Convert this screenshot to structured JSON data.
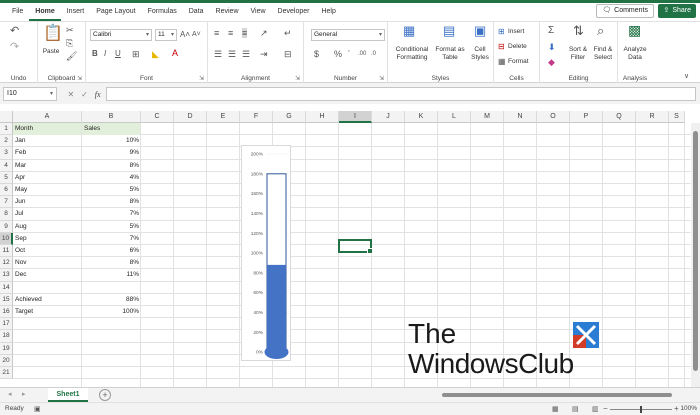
{
  "menu": {
    "tabs": [
      "File",
      "Home",
      "Insert",
      "Page Layout",
      "Formulas",
      "Data",
      "Review",
      "View",
      "Developer",
      "Help"
    ],
    "active": "Home",
    "comments_label": "Comments",
    "share_label": "Share"
  },
  "ribbon": {
    "undo_group": "Undo",
    "clipboard_group": "Clipboard",
    "paste_label": "Paste",
    "font_group": "Font",
    "font_name": "Calibri",
    "font_size": "11",
    "alignment_group": "Alignment",
    "number_group": "Number",
    "number_format": "General",
    "styles_group": "Styles",
    "conditional_formatting": "Conditional Formatting",
    "format_as_table": "Format as Table",
    "cell_styles": "Cell Styles",
    "cells_group": "Cells",
    "insert_label": "Insert",
    "delete_label": "Delete",
    "format_label": "Format",
    "editing_group": "Editing",
    "sort_filter": "Sort & Filter",
    "find_select": "Find & Select",
    "analysis_group": "Analysis",
    "analyze_data": "Analyze Data"
  },
  "formula_bar": {
    "name_box": "I10",
    "fx": "fx",
    "formula": ""
  },
  "columns": [
    "A",
    "B",
    "C",
    "D",
    "E",
    "F",
    "G",
    "H",
    "I",
    "J",
    "K",
    "L",
    "M",
    "N",
    "O",
    "P",
    "Q",
    "R",
    "S"
  ],
  "selected_column": "I",
  "selected_row": "10",
  "rows": [
    {
      "n": "1",
      "a": "Month",
      "b": "Sales",
      "header": true
    },
    {
      "n": "2",
      "a": "Jan",
      "b": "10%"
    },
    {
      "n": "3",
      "a": "Feb",
      "b": "9%"
    },
    {
      "n": "4",
      "a": "Mar",
      "b": "8%"
    },
    {
      "n": "5",
      "a": "Apr",
      "b": "4%"
    },
    {
      "n": "6",
      "a": "May",
      "b": "5%"
    },
    {
      "n": "7",
      "a": "Jun",
      "b": "8%"
    },
    {
      "n": "8",
      "a": "Jul",
      "b": "7%"
    },
    {
      "n": "9",
      "a": "Aug",
      "b": "5%"
    },
    {
      "n": "10",
      "a": "Sep",
      "b": "7%"
    },
    {
      "n": "11",
      "a": "Oct",
      "b": "6%"
    },
    {
      "n": "12",
      "a": "Nov",
      "b": "8%"
    },
    {
      "n": "13",
      "a": "Dec",
      "b": "11%"
    },
    {
      "n": "14",
      "a": "",
      "b": ""
    },
    {
      "n": "15",
      "a": "Achieved",
      "b": "88%"
    },
    {
      "n": "16",
      "a": "Target",
      "b": "100%"
    },
    {
      "n": "17",
      "a": "",
      "b": ""
    },
    {
      "n": "18",
      "a": "",
      "b": ""
    },
    {
      "n": "19",
      "a": "",
      "b": ""
    },
    {
      "n": "20",
      "a": "",
      "b": ""
    },
    {
      "n": "21",
      "a": "",
      "b": ""
    }
  ],
  "chart_data": {
    "type": "bar",
    "series": [
      {
        "values": [
          0.88
        ]
      },
      {
        "values": [
          1.0
        ]
      }
    ],
    "ylim": [
      0,
      2.0
    ],
    "y_ticks": [
      "0%",
      "20%",
      "40%",
      "60%",
      "80%",
      "100%",
      "120%",
      "140%",
      "160%",
      "180%",
      "200%"
    ],
    "fill_color": "#4472c4",
    "outline_color": "#2e5597"
  },
  "sheets": {
    "tabs": [
      "Sheet1"
    ]
  },
  "status": {
    "ready": "Ready",
    "zoom": "100%"
  },
  "watermark": {
    "line1": "The",
    "line2": "WindowsClub"
  }
}
